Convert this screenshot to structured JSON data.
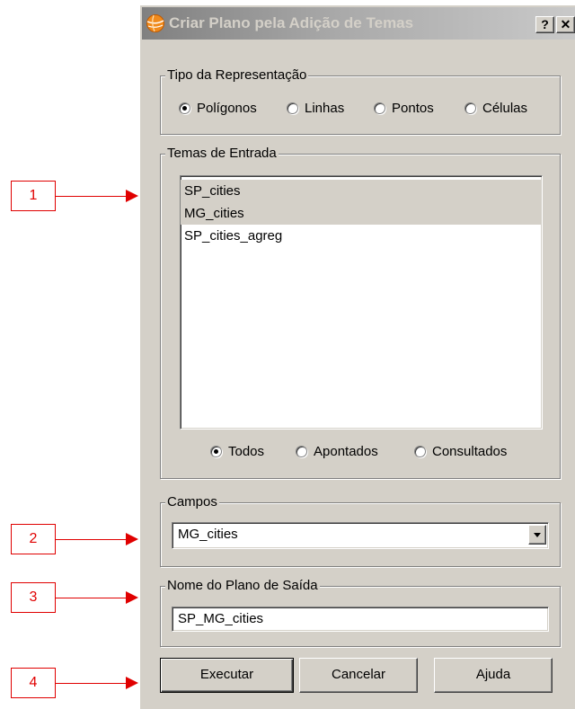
{
  "window": {
    "title": "Criar Plano pela Adição de Temas",
    "help_label": "?",
    "close_label": "✕",
    "app_icon": "globe-icon"
  },
  "tipo": {
    "legend": "Tipo da Representação",
    "options": [
      "Polígonos",
      "Linhas",
      "Pontos",
      "Células"
    ],
    "selected": "Polígonos"
  },
  "temas": {
    "legend": "Temas de Entrada",
    "items": [
      "SP_cities",
      "MG_cities",
      "SP_cities_agreg"
    ],
    "selected_items": [
      "SP_cities",
      "MG_cities"
    ],
    "filter_options": [
      "Todos",
      "Apontados",
      "Consultados"
    ],
    "filter_selected": "Todos"
  },
  "campos": {
    "legend": "Campos",
    "value": "MG_cities"
  },
  "nome": {
    "legend": "Nome do Plano de Saída",
    "value": "SP_MG_cities"
  },
  "buttons": {
    "executar": "Executar",
    "cancelar": "Cancelar",
    "ajuda": "Ajuda"
  },
  "callouts": [
    "1",
    "2",
    "3",
    "4"
  ],
  "colors": {
    "dialog_bg": "#d4d0c8",
    "callout": "#e00000"
  }
}
